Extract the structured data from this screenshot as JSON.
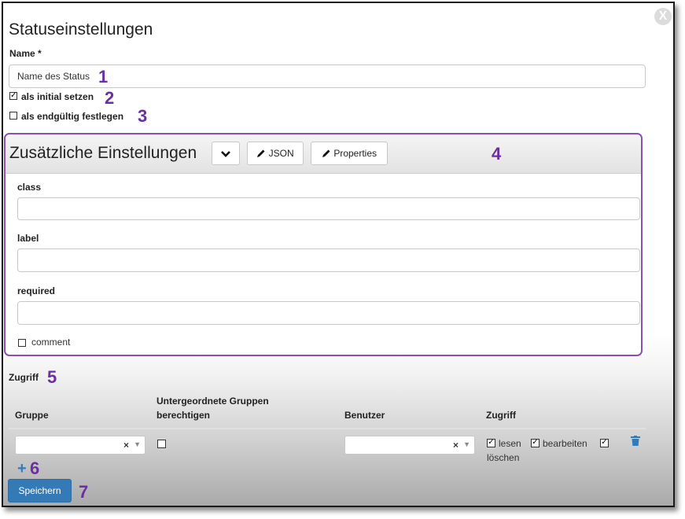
{
  "dialog": {
    "title": "Statuseinstellungen",
    "close_symbol": "X"
  },
  "name_field": {
    "label": "Name *",
    "value": "Name des Status"
  },
  "options": {
    "initial_label": "als initial setzen",
    "initial_checked": true,
    "final_label": "als endgültig festlegen",
    "final_checked": false
  },
  "extra_settings": {
    "title": "Zusätzliche Einstellungen",
    "json_button": "JSON",
    "properties_button": "Properties",
    "fields": [
      {
        "label": "class",
        "value": ""
      },
      {
        "label": "label",
        "value": ""
      },
      {
        "label": "required",
        "value": ""
      }
    ],
    "comment_label": "comment",
    "comment_checked": false
  },
  "access": {
    "title": "Zugriff",
    "headers": {
      "group": "Gruppe",
      "subgroups": "Untergeordnete Gruppen berechtigen",
      "user": "Benutzer",
      "access": "Zugriff"
    },
    "row": {
      "group_value": "",
      "user_value": "",
      "clear_symbol": "×",
      "read_label": "lesen",
      "edit_label": "bearbeiten",
      "delete_label": "löschen"
    },
    "add_symbol": "+"
  },
  "save_button": "Speichern",
  "annotations": [
    "1",
    "2",
    "3",
    "4",
    "5",
    "6",
    "7"
  ],
  "colors": {
    "annotation": "#6b2fa0",
    "panel_border": "#8a4fb0",
    "primary_button": "#337ab7",
    "delete_icon": "#337ab7"
  },
  "icons": [
    "close-icon",
    "chevron-down-icon",
    "pencil-icon",
    "checkbox-icon",
    "trash-icon",
    "plus-icon",
    "caret-down-icon"
  ]
}
